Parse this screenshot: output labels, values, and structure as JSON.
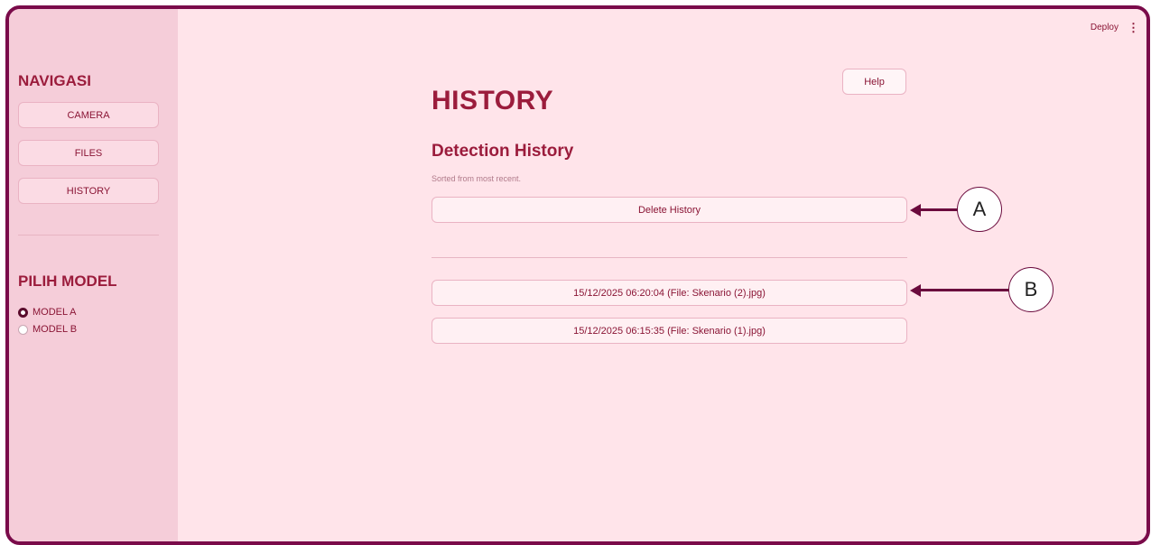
{
  "sidebar": {
    "nav_heading": "NAVIGASI",
    "nav_items": [
      {
        "label": "CAMERA"
      },
      {
        "label": "FILES"
      },
      {
        "label": "HISTORY"
      }
    ],
    "model_heading": "PILIH MODEL",
    "models": [
      {
        "label": "MODEL A",
        "selected": true
      },
      {
        "label": "MODEL B",
        "selected": false
      }
    ]
  },
  "topbar": {
    "deploy_label": "Deploy",
    "menu_icon": "kebab-menu-icon"
  },
  "main": {
    "title": "HISTORY",
    "help_label": "Help",
    "subtitle": "Detection History",
    "caption": "Sorted from most recent.",
    "delete_label": "Delete History",
    "entries": [
      {
        "label": "15/12/2025 06:20:04 (File: Skenario (2).jpg)"
      },
      {
        "label": "15/12/2025 06:15:35 (File: Skenario (1).jpg)"
      }
    ]
  },
  "annotations": [
    {
      "label": "A"
    },
    {
      "label": "B"
    }
  ],
  "colors": {
    "frame_border": "#7a0b4a",
    "sidebar_bg": "#f5cdd9",
    "main_bg": "#ffe4ea",
    "accent_text": "#9b1c3c"
  }
}
